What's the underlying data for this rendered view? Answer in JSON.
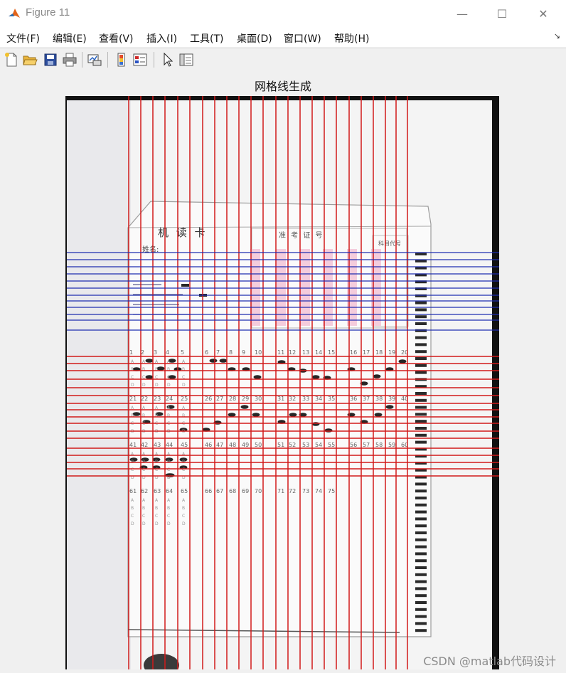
{
  "window": {
    "title": "Figure 11",
    "controls": {
      "minimize": "—",
      "maximize": "☐",
      "close": "✕"
    }
  },
  "menu": {
    "items": [
      "文件(F)",
      "编辑(E)",
      "查看(V)",
      "插入(I)",
      "工具(T)",
      "桌面(D)",
      "窗口(W)",
      "帮助(H)"
    ],
    "dock_arrow": "↘"
  },
  "toolbar": {
    "icons": [
      "new-figure-icon",
      "open-file-icon",
      "save-icon",
      "print-icon",
      "link-plot-icon",
      "colorbar-icon",
      "legend-icon",
      "pointer-icon",
      "property-editor-icon"
    ]
  },
  "axes": {
    "title": "网格线生成"
  },
  "image": {
    "card_title": "机 读 卡",
    "name_label": "姓名:",
    "exam_no_label": "准 考 证 号",
    "subject_label": "科目代号",
    "question_numbers_row1": [
      "1",
      "2",
      "3",
      "4",
      "5",
      "6",
      "7",
      "8",
      "9",
      "10",
      "11",
      "12",
      "13",
      "14",
      "15",
      "16",
      "17",
      "18",
      "19",
      "20"
    ],
    "question_numbers_row2": [
      "21",
      "22",
      "23",
      "24",
      "25",
      "26",
      "27",
      "28",
      "29",
      "30",
      "31",
      "32",
      "33",
      "34",
      "35",
      "36",
      "37",
      "38",
      "39",
      "40"
    ],
    "question_numbers_row3": [
      "41",
      "42",
      "43",
      "44",
      "45",
      "46",
      "47",
      "48",
      "49",
      "50",
      "51",
      "52",
      "53",
      "54",
      "55",
      "56",
      "57",
      "58",
      "59",
      "60"
    ],
    "question_numbers_row4": [
      "61",
      "62",
      "63",
      "64",
      "65",
      "66",
      "67",
      "68",
      "69",
      "70",
      "71",
      "72",
      "73",
      "74",
      "75"
    ],
    "options": [
      "A",
      "B",
      "C",
      "D"
    ]
  },
  "grid": {
    "colors": {
      "red": "#d11a1a",
      "blue": "#1f2db0"
    }
  },
  "watermark": "CSDN @matlab代码设计"
}
